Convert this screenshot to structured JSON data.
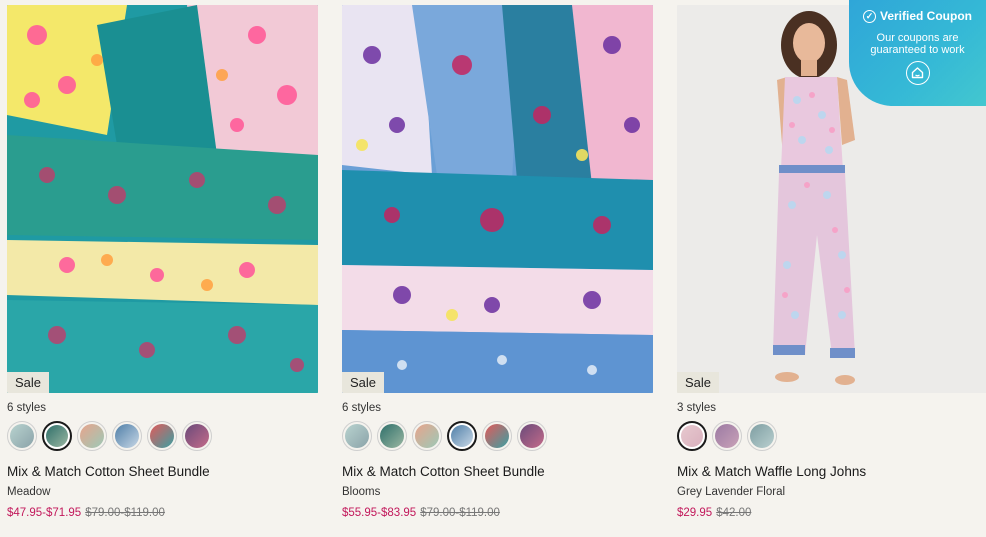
{
  "products": [
    {
      "badge": "Sale",
      "styles_count": "6 styles",
      "title": "Mix & Match Cotton Sheet Bundle",
      "variant": "Meadow",
      "price_now": "$47.95-$71.95",
      "price_was": "$79.00-$119.00",
      "image_icon": "floral-sheets-meadow-photo",
      "swatches": [
        {
          "colors": [
            "#b9d3cf",
            "#8aa3a9"
          ],
          "selected": false
        },
        {
          "colors": [
            "#2e6f6a",
            "#9ab7a2"
          ],
          "selected": true
        },
        {
          "colors": [
            "#e8a48c",
            "#9cc9b7"
          ],
          "selected": false
        },
        {
          "colors": [
            "#4f7fa8",
            "#c7d7e6"
          ],
          "selected": false
        },
        {
          "colors": [
            "#e25a5a",
            "#3aa0a3"
          ],
          "selected": false
        },
        {
          "colors": [
            "#6a4a7a",
            "#c46b8a"
          ],
          "selected": false
        }
      ]
    },
    {
      "badge": "Sale",
      "styles_count": "6 styles",
      "title": "Mix & Match Cotton Sheet Bundle",
      "variant": "Blooms",
      "price_now": "$55.95-$83.95",
      "price_was": "$79.00-$119.00",
      "image_icon": "floral-sheets-blooms-photo",
      "swatches": [
        {
          "colors": [
            "#b9d3cf",
            "#8aa3a9"
          ],
          "selected": false
        },
        {
          "colors": [
            "#2e6f6a",
            "#9ab7a2"
          ],
          "selected": false
        },
        {
          "colors": [
            "#e8a48c",
            "#9cc9b7"
          ],
          "selected": false
        },
        {
          "colors": [
            "#4f7fa8",
            "#c7d7e6"
          ],
          "selected": true
        },
        {
          "colors": [
            "#e25a5a",
            "#3aa0a3"
          ],
          "selected": false
        },
        {
          "colors": [
            "#6a4a7a",
            "#c46b8a"
          ],
          "selected": false
        }
      ]
    },
    {
      "badge": "Sale",
      "styles_count": "3 styles",
      "title": "Mix & Match Waffle Long Johns",
      "variant": "Grey Lavender Floral",
      "price_now": "$29.95",
      "price_was": "$42.00",
      "image_icon": "woman-in-floral-pajamas-photo",
      "swatches": [
        {
          "colors": [
            "#e7c9cf",
            "#d9b0bd"
          ],
          "selected": true
        },
        {
          "colors": [
            "#9b7aa3",
            "#c9a2b8"
          ],
          "selected": false
        },
        {
          "colors": [
            "#7e9ea2",
            "#b9cfcf"
          ],
          "selected": false
        }
      ]
    }
  ],
  "coupon": {
    "title": "Verified Coupon",
    "subtitle": "Our coupons are guaranteed to work",
    "icon": "home-icon",
    "check_icon": "check-circle-icon",
    "bg_color": "#35b3d8"
  }
}
